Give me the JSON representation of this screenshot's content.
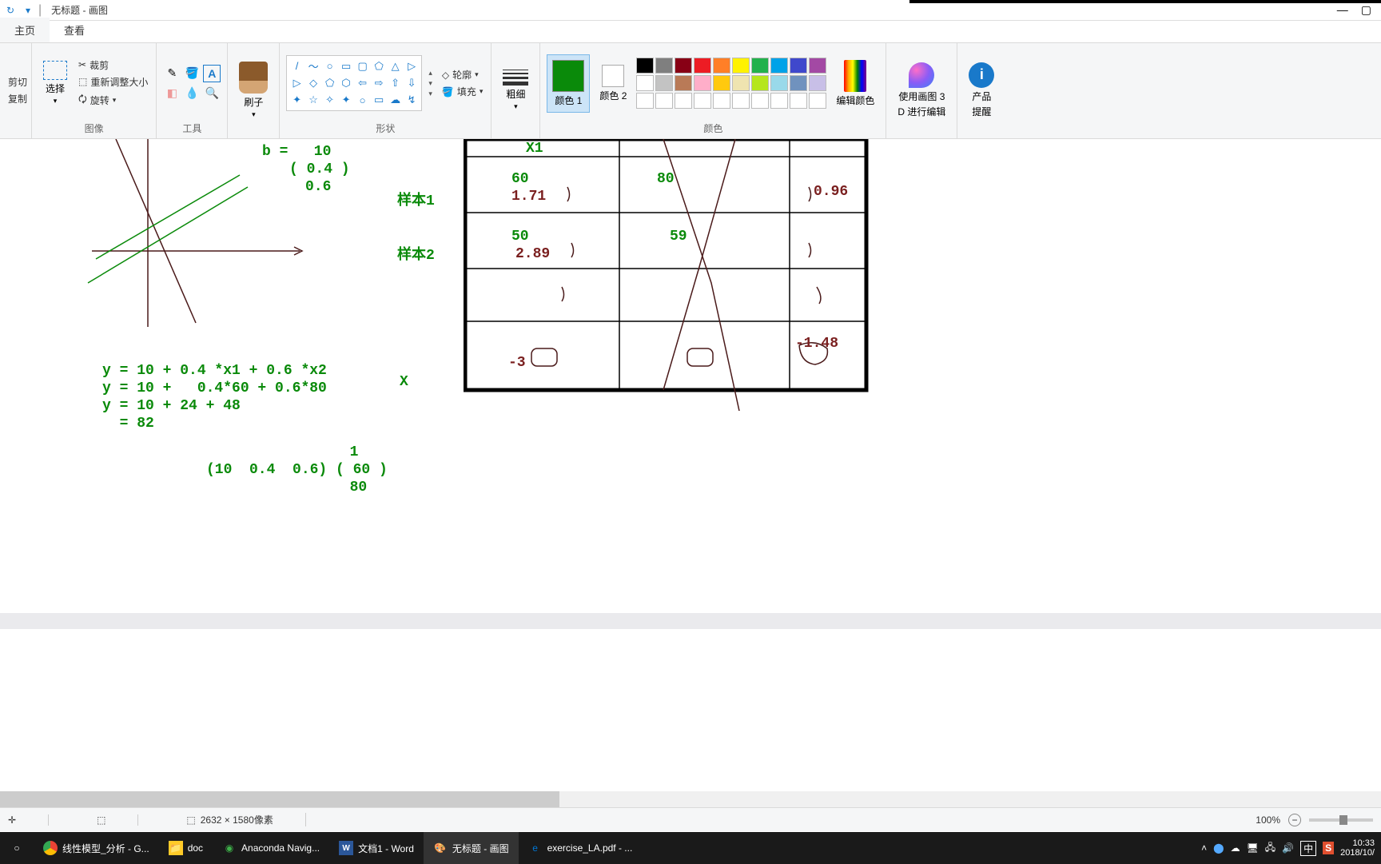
{
  "window": {
    "title": "无标题 - 画图"
  },
  "tabs": {
    "home": "主页",
    "view": "查看"
  },
  "clipboard": {
    "cut": "剪切",
    "copy": "复制"
  },
  "image": {
    "select": "选择",
    "crop": "裁剪",
    "resize": "重新调整大小",
    "rotate": "旋转",
    "label": "图像"
  },
  "tools": {
    "label": "工具"
  },
  "brush": {
    "label": "刷子"
  },
  "shapes": {
    "outline": "轮廓",
    "fill": "填充",
    "label": "形状"
  },
  "stroke": {
    "label": "粗细"
  },
  "colors": {
    "c1": "颜色 1",
    "c2": "颜色 2",
    "edit": "编辑颜色",
    "label": "颜色"
  },
  "paint3d": {
    "line1": "使用画图 3",
    "line2": "D 进行编辑"
  },
  "tips": {
    "line1": "产品",
    "line2": "提醒"
  },
  "canvas": {
    "b_eq": "b =   10",
    "b_vec1": "( 0.4 )",
    "b_vec2": "0.6",
    "sample1": "样本1",
    "sample2": "样本2",
    "X": "X",
    "eq1": "y = 10 + 0.4 *x1 + 0.6 *x2",
    "eq2": "y = 10 +   0.4*60 + 0.6*80",
    "eq3": "y = 10 + 24 + 48",
    "eq4": "  = 82",
    "mat1": "            1",
    "mat2": "(10  0.4  0.6) ( 60 )",
    "mat3": "            80",
    "th1": "X1",
    "r1c1": "60",
    "r1c2": "80",
    "r1c3": "0.96",
    "r1v": "1.71",
    "r2c1": "50",
    "r2c2": "59",
    "r2v": "2.89",
    "r4c1": "-3",
    "r4c3": "-1.48"
  },
  "status": {
    "dims": "2632 × 1580像素",
    "zoom": "100%"
  },
  "taskbar": {
    "chrome": "线性模型_分析 - G...",
    "explorer": "doc",
    "anaconda": "Anaconda Navig...",
    "word": "文档1 - Word",
    "paint": "无标题 - 画图",
    "edge": "exercise_LA.pdf - ...",
    "ime": "中",
    "time": "10:33",
    "date": "2018/10/"
  }
}
